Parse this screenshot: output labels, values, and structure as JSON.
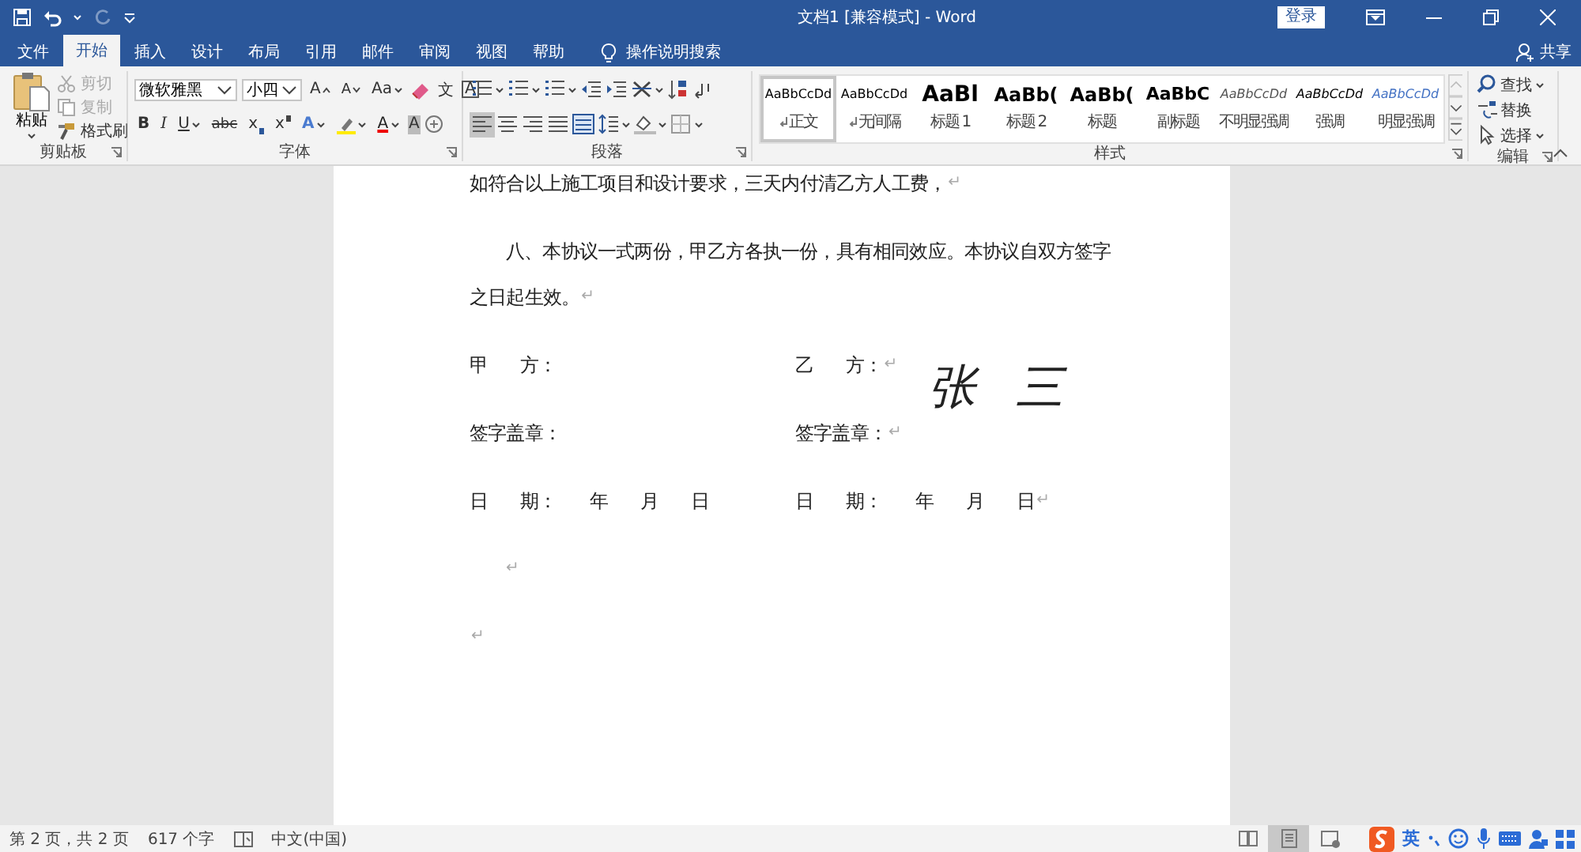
{
  "window": {
    "title": "文档1 [兼容模式] - Word",
    "sign_in": "登录"
  },
  "tabs": [
    {
      "label": "文件",
      "selected": false
    },
    {
      "label": "开始",
      "selected": true
    },
    {
      "label": "插入",
      "selected": false
    },
    {
      "label": "设计",
      "selected": false
    },
    {
      "label": "布局",
      "selected": false
    },
    {
      "label": "引用",
      "selected": false
    },
    {
      "label": "邮件",
      "selected": false
    },
    {
      "label": "审阅",
      "selected": false
    },
    {
      "label": "视图",
      "selected": false
    },
    {
      "label": "帮助",
      "selected": false
    }
  ],
  "tell_me": "操作说明搜索",
  "share": "共享",
  "clipboard": {
    "label": "剪贴板",
    "paste": "粘贴",
    "items": [
      {
        "label": "剪切",
        "kind": "cut",
        "disabled": true
      },
      {
        "label": "复制",
        "kind": "copy",
        "disabled": true
      },
      {
        "label": "格式刷",
        "kind": "painter",
        "disabled": false
      }
    ]
  },
  "font": {
    "label": "字体",
    "name": "微软雅黑",
    "size": "小四",
    "row1": [
      {
        "glyph": "A",
        "kind": "grow"
      },
      {
        "glyph": "A",
        "kind": "shrink"
      },
      {
        "glyph": "Aa",
        "kind": "case"
      },
      {
        "glyph": "文",
        "kind": "phonetic"
      },
      {
        "glyph": "A",
        "kind": "border"
      }
    ],
    "row2": [
      {
        "glyph": "B",
        "kind": "bold"
      },
      {
        "glyph": "I",
        "kind": "italic"
      },
      {
        "glyph": "U",
        "kind": "underline"
      },
      {
        "glyph": "abc",
        "kind": "strike"
      },
      {
        "glyph": "x",
        "kind": "sub"
      },
      {
        "glyph": "x",
        "kind": "sup"
      },
      {
        "glyph": "A",
        "kind": "effect"
      },
      {
        "glyph": "A",
        "kind": "color"
      },
      {
        "glyph": "A",
        "kind": "shade"
      }
    ]
  },
  "paragraph": {
    "label": "段落",
    "alignments": [
      {
        "selected": true
      },
      {
        "selected": false
      },
      {
        "selected": false
      },
      {
        "selected": false
      },
      {
        "selected": false
      }
    ]
  },
  "styles": {
    "label": "样式",
    "items": [
      {
        "preview": "AaBbCcDd",
        "name": "正文",
        "kind": "normal",
        "paragraph_mark": true,
        "selected": true
      },
      {
        "preview": "AaBbCcDd",
        "name": "无间隔",
        "kind": "normal",
        "paragraph_mark": true,
        "selected": false
      },
      {
        "preview": "AaBl",
        "name": "标题 1",
        "kind": "heading1",
        "paragraph_mark": false,
        "selected": false
      },
      {
        "preview": "AaBb(",
        "name": "标题 2",
        "kind": "heading2",
        "paragraph_mark": false,
        "selected": false
      },
      {
        "preview": "AaBb(",
        "name": "标题",
        "kind": "title",
        "paragraph_mark": false,
        "selected": false
      },
      {
        "preview": "AaBbC",
        "name": "副标题",
        "kind": "subtitle",
        "paragraph_mark": false,
        "selected": false
      },
      {
        "preview": "AaBbCcDd",
        "name": "不明显强调",
        "kind": "subtle",
        "paragraph_mark": false,
        "selected": false
      },
      {
        "preview": "AaBbCcDd",
        "name": "强调",
        "kind": "emphasis",
        "paragraph_mark": false,
        "selected": false
      },
      {
        "preview": "AaBbCcDd",
        "name": "明显强调",
        "kind": "intense",
        "paragraph_mark": false,
        "selected": false
      }
    ]
  },
  "editing": {
    "label": "编辑",
    "items": [
      {
        "label": "查找",
        "kind": "find"
      },
      {
        "label": "替换",
        "kind": "replace"
      },
      {
        "label": "选择",
        "kind": "select"
      }
    ]
  },
  "document": {
    "paragraphs": [
      {
        "lines": [
          "如符合以上施工项目和设计要求，三天内付清乙方人工费，"
        ],
        "kind": "plain",
        "mark": "↵"
      },
      {
        "lines": [
          "八、本协议一式两份，甲乙方各执一份，具有相同效应。本协议自双方签字",
          "之日起生效。"
        ],
        "kind": "indented",
        "mark": "↵"
      }
    ],
    "signature_rows": [
      {
        "left": "甲      方：",
        "right": "乙      方：",
        "mark": "↵"
      },
      {
        "left": "签字盖章：",
        "right": "签字盖章：",
        "mark": "↵"
      },
      {
        "left": "日      期：      年      月      日",
        "right": "日      期：      年      月      日",
        "mark": "↵"
      }
    ],
    "trailing": [
      {
        "kind": "indented",
        "mark": "↵"
      },
      {
        "kind": "plain",
        "mark": "↵"
      }
    ],
    "signature": "张 三"
  },
  "status_bar": {
    "page": "第 2 页，共 2 页",
    "words": "617 个字",
    "language": "中文(中国)",
    "views": [
      {
        "selected": false
      },
      {
        "selected": true
      },
      {
        "selected": false
      }
    ]
  },
  "ime": {
    "mode": "英"
  }
}
